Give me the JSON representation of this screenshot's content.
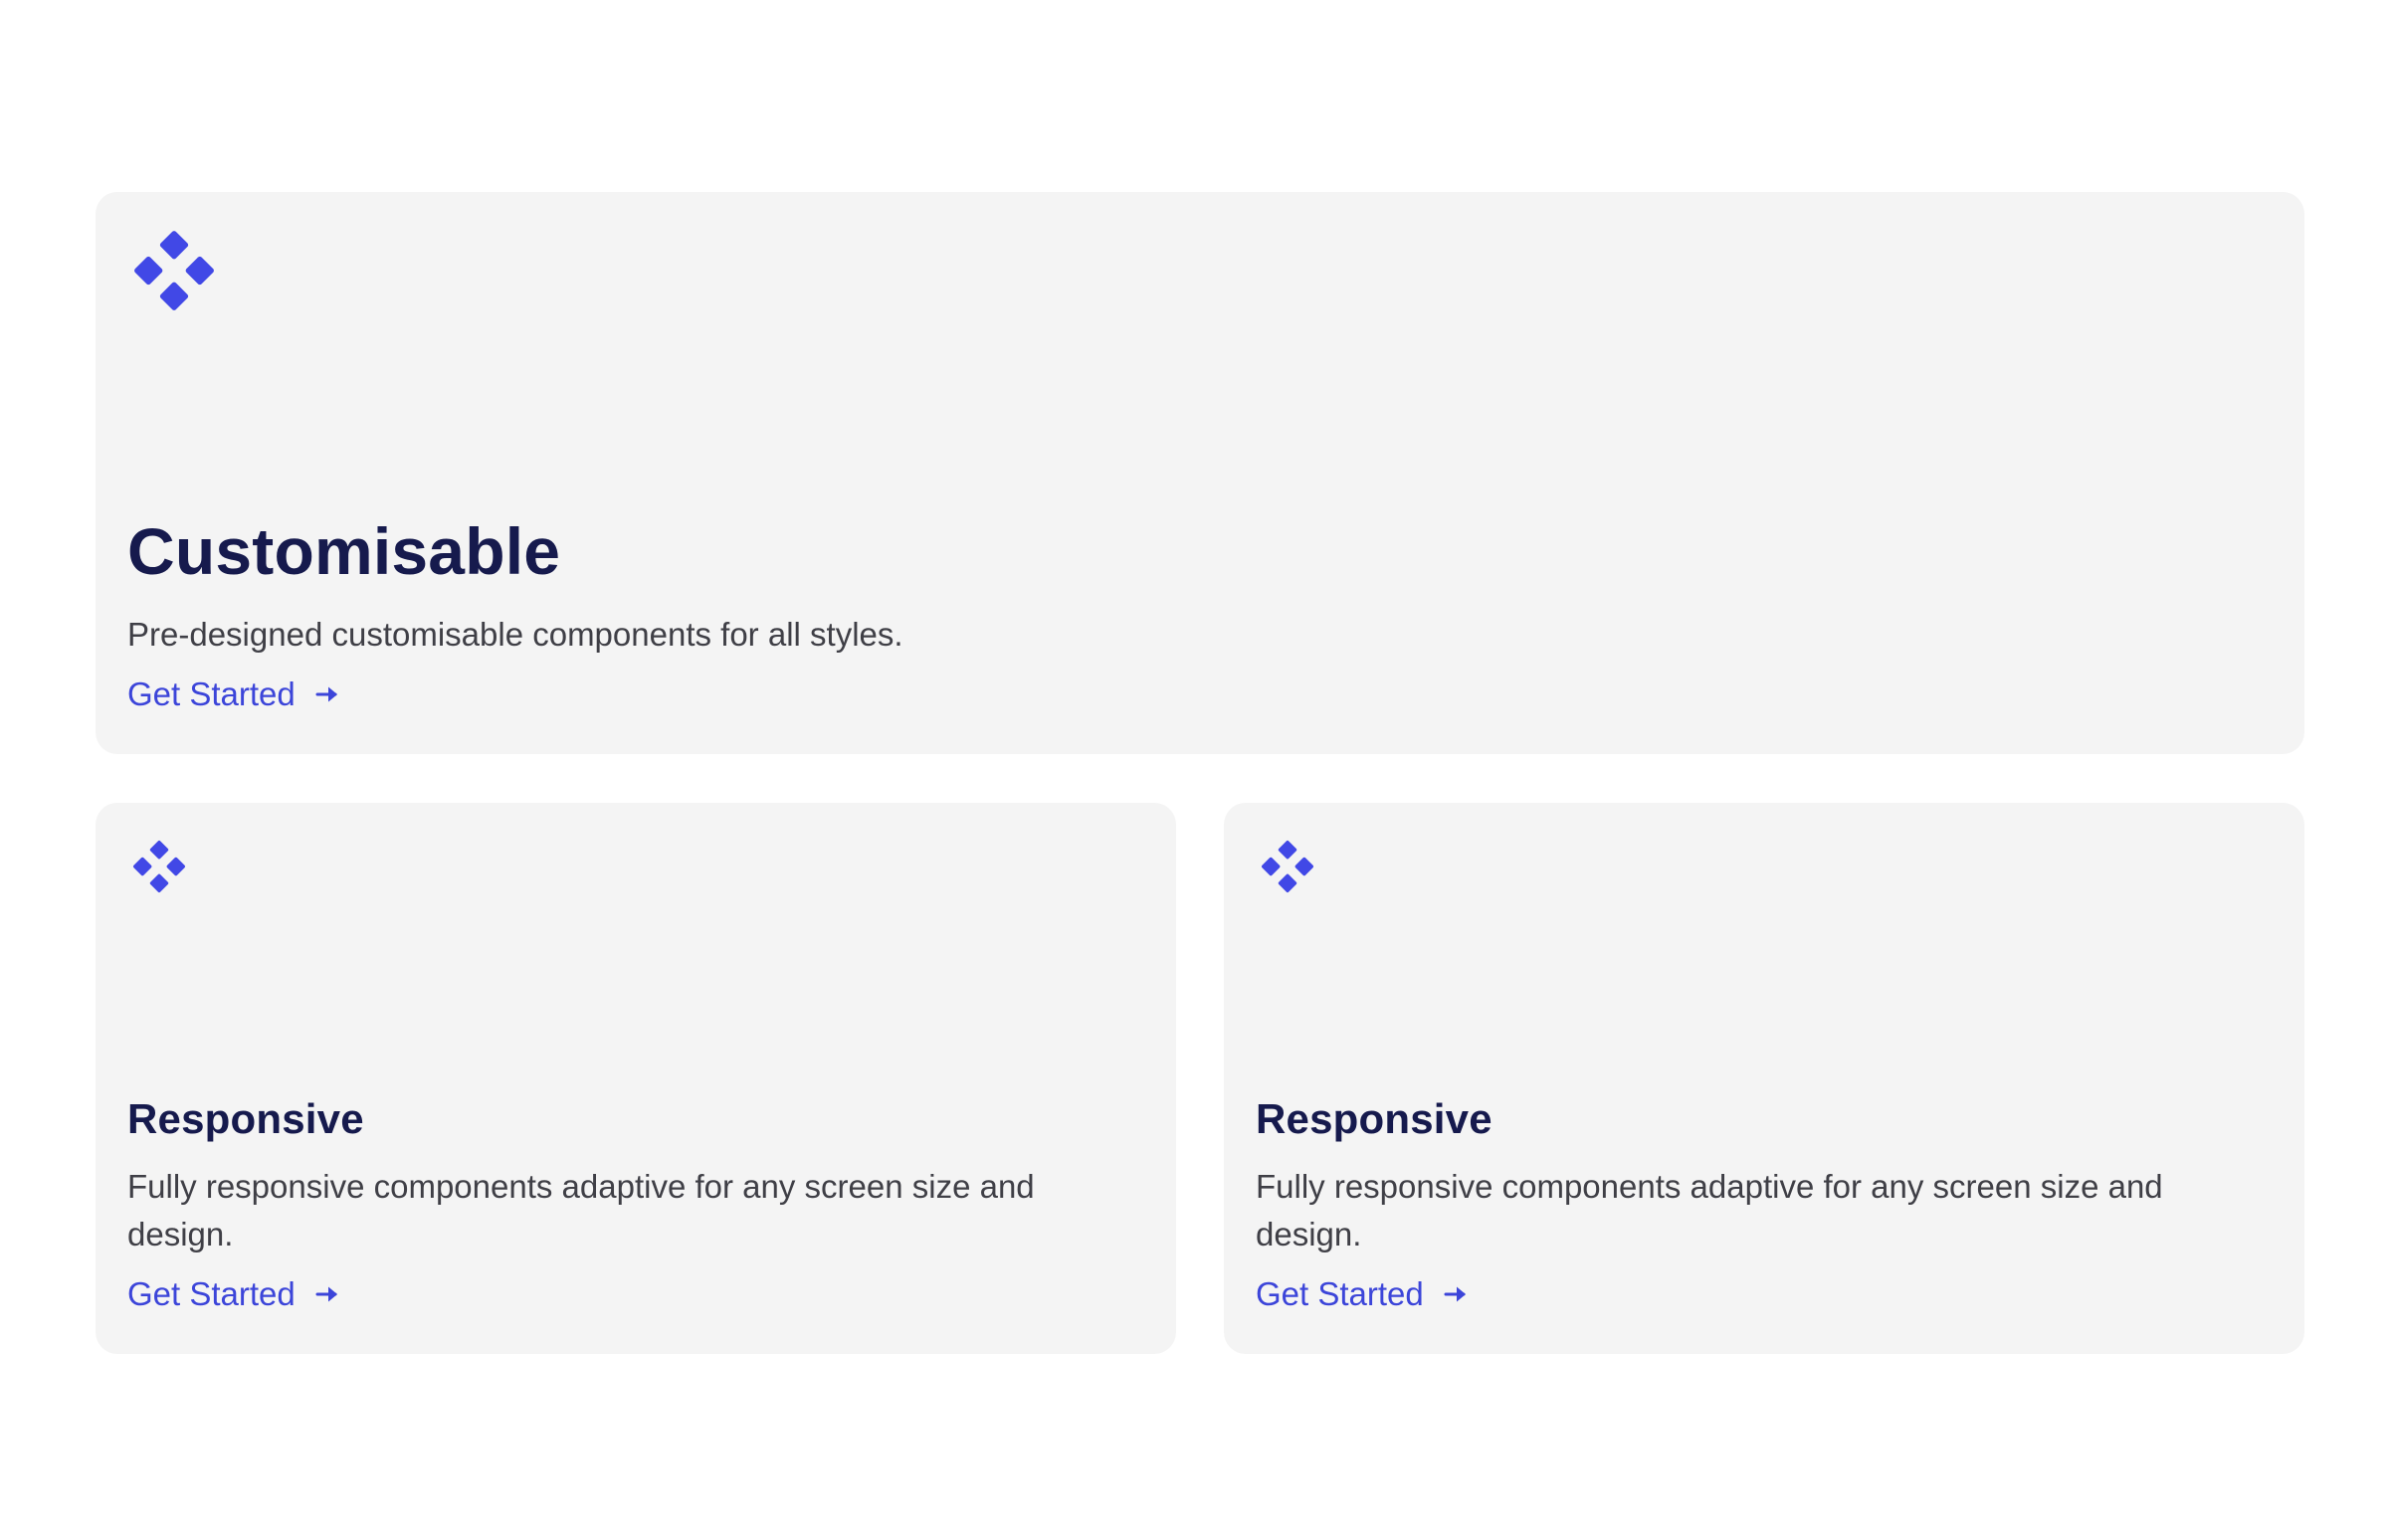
{
  "colors": {
    "card_background": "#f4f4f4",
    "accent": "#4148e6",
    "title": "#161a4d",
    "body_text": "#3f3f46",
    "link": "#3c45d9"
  },
  "cards": [
    {
      "icon": "diamond-cluster-icon",
      "title": "Customisable",
      "description": "Pre-designed customisable components for all styles.",
      "link_label": "Get Started",
      "link_icon": "arrow-right-icon"
    },
    {
      "icon": "diamond-cluster-icon",
      "title": "Responsive",
      "description": "Fully responsive components adaptive for any screen size and design.",
      "link_label": "Get Started",
      "link_icon": "arrow-right-icon"
    },
    {
      "icon": "diamond-cluster-icon",
      "title": "Responsive",
      "description": "Fully responsive components adaptive for any screen size and design.",
      "link_label": "Get Started",
      "link_icon": "arrow-right-icon"
    }
  ]
}
